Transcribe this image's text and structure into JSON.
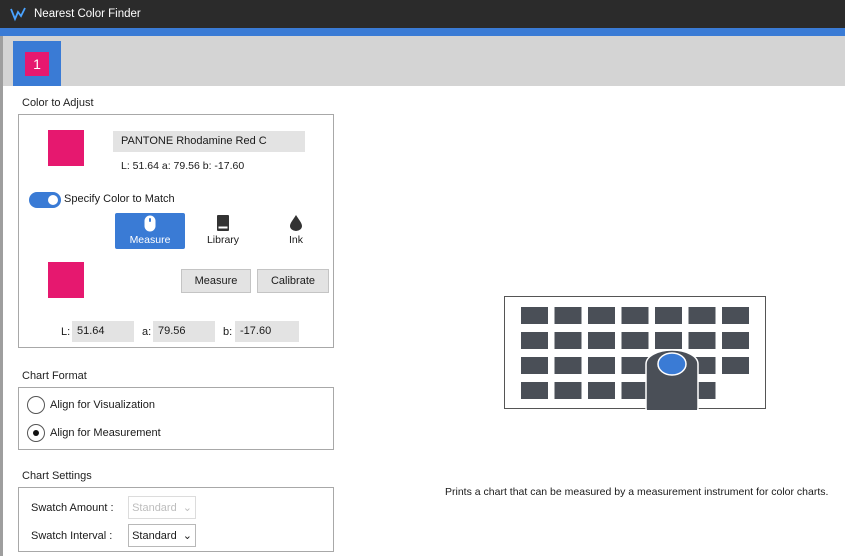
{
  "window": {
    "title": "Nearest Color Finder",
    "icon": "app-logo-icon"
  },
  "tabs": [
    {
      "label": "1",
      "color": "#e6186f",
      "active": true
    }
  ],
  "color_to_adjust": {
    "section_label": "Color to Adjust",
    "target_swatch_color": "#e6186f",
    "color_name": "PANTONE Rhodamine Red C",
    "lab_readout": "L: 51.64 a: 79.56 b: -17.60",
    "specify_toggle": {
      "label": "Specify Color to Match",
      "on": true
    },
    "source_buttons": [
      {
        "label": "Measure",
        "icon": "mouse-icon",
        "active": true
      },
      {
        "label": "Library",
        "icon": "book-icon",
        "active": false
      },
      {
        "label": "Ink",
        "icon": "ink-drop-icon",
        "active": false
      }
    ],
    "match_swatch_color": "#e6186f",
    "measure_button": "Measure",
    "calibrate_button": "Calibrate",
    "lab_fields": {
      "L": {
        "label": "L:",
        "value": "51.64"
      },
      "a": {
        "label": "a:",
        "value": "79.56"
      },
      "b": {
        "label": "b:",
        "value": "-17.60"
      }
    }
  },
  "chart_format": {
    "section_label": "Chart Format",
    "options": [
      {
        "label": "Align for Visualization",
        "checked": false
      },
      {
        "label": "Align for Measurement",
        "checked": true
      }
    ]
  },
  "chart_settings": {
    "section_label": "Chart Settings",
    "swatch_amount": {
      "label": "Swatch Amount :",
      "value": "Standard",
      "disabled": true
    },
    "swatch_interval": {
      "label": "Swatch Interval :",
      "value": "Standard",
      "disabled": false
    }
  },
  "illustration": {
    "icon": "measurement-chart-illustration",
    "description": "Prints a chart that can be measured by a measurement instrument for color charts."
  },
  "colors": {
    "accent": "#3a7bd5",
    "magenta": "#e6186f",
    "titlebar": "#2b2b2b",
    "patch": "#4a4f57"
  }
}
